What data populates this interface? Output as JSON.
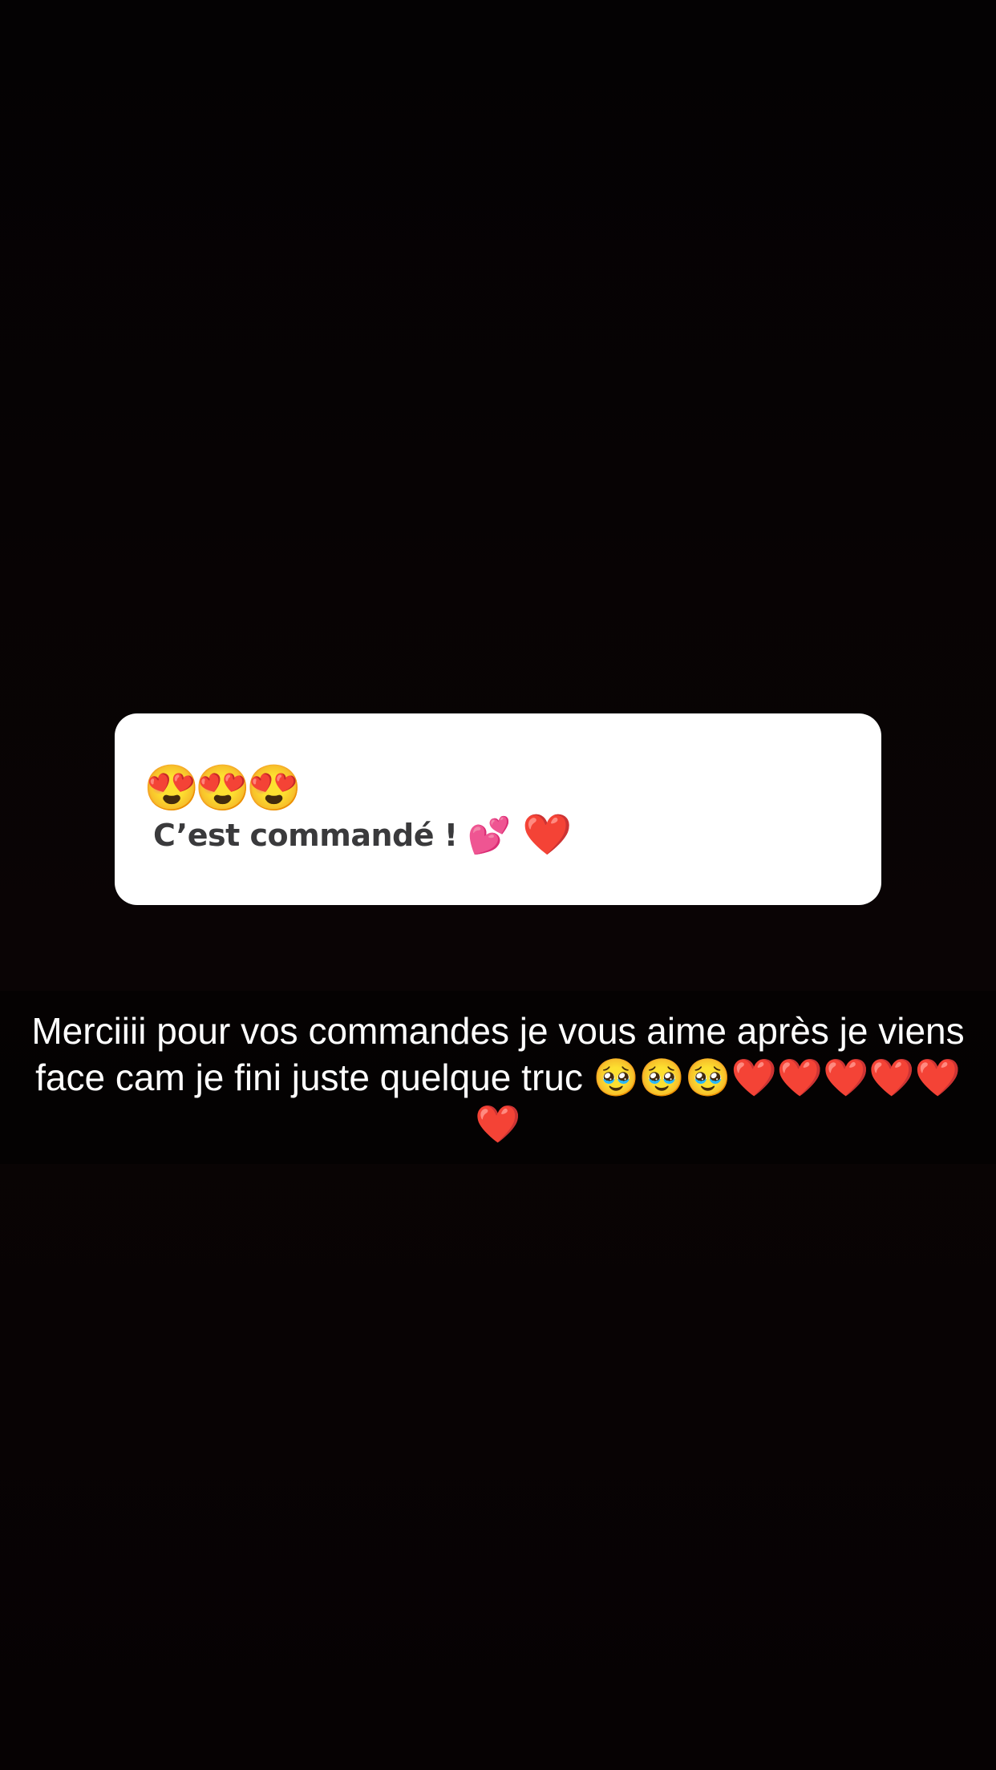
{
  "sticker": {
    "emojis_top": "😍😍😍",
    "text": "C’est commandé !",
    "emoji_after_text": "💕",
    "emoji_heart": "❤️"
  },
  "caption": {
    "text": "Merciiii pour vos commandes je vous aime après je viens face cam je fini juste quelque truc 🥹🥹🥹❤️❤️❤️❤️❤️❤️"
  },
  "colors": {
    "background": "#050203",
    "sticker_background": "#ffffff",
    "sticker_text": "#3a3a3c",
    "caption_text": "#ffffff"
  }
}
